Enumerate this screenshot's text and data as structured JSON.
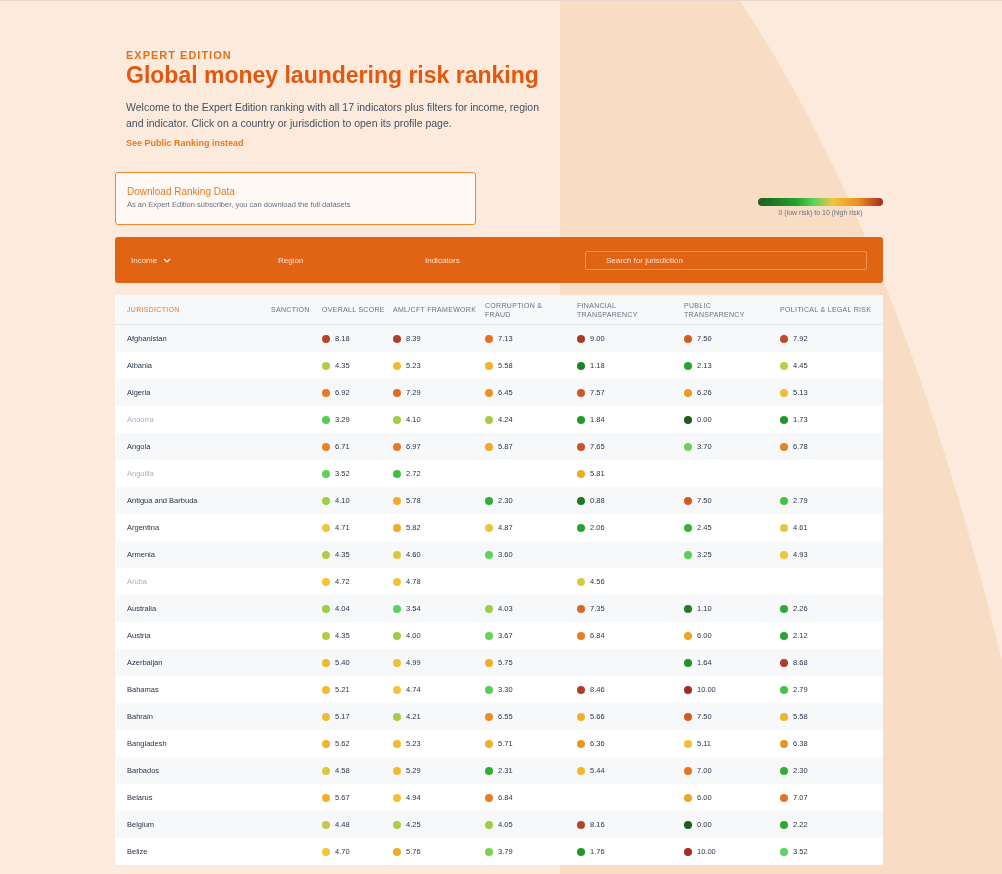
{
  "header": {
    "eyebrow": "EXPERT EDITION",
    "title": "Global money laundering risk ranking",
    "intro": "Welcome to the Expert Edition ranking with all 17 indicators plus filters for income, region and indicator. Click on a country or jurisdiction to open its profile page.",
    "public_link": "See Public Ranking instead"
  },
  "download": {
    "title": "Download Ranking Data",
    "text": "As an Expert Edition subscriber, you can download the full datasets"
  },
  "legend": {
    "caption": "0 (low risk) to 10 (high risk)"
  },
  "filters": [
    {
      "label": "Income",
      "dropdown": true
    },
    {
      "label": "Region",
      "dropdown": false
    },
    {
      "label": "Indicators",
      "dropdown": false
    }
  ],
  "search": {
    "placeholder": "Search for jurisdiction"
  },
  "table": {
    "columns": [
      "JURISDICTION",
      "SANCTION",
      "OVERALL SCORE",
      "AML/CFT FRAMEWORK",
      "CORRUPTION & FRAUD",
      "FINANCIAL TRANSPARENCY",
      "PUBLIC TRANSPARENCY",
      "POLITICAL & LEGAL RISK"
    ],
    "rows": [
      {
        "name": "Afghanistan",
        "disabled": false,
        "scores": {
          "overall": "8.18",
          "aml": "8.39",
          "corruption": "7.13",
          "financial": "9.00",
          "public": "7.50",
          "political": "7.92"
        }
      },
      {
        "name": "Albania",
        "disabled": false,
        "scores": {
          "overall": "4.35",
          "aml": "5.23",
          "corruption": "5.58",
          "financial": "1.18",
          "public": "2.13",
          "political": "4.45"
        }
      },
      {
        "name": "Algeria",
        "disabled": false,
        "scores": {
          "overall": "6.92",
          "aml": "7.29",
          "corruption": "6.45",
          "financial": "7.57",
          "public": "6.26",
          "political": "5.13"
        }
      },
      {
        "name": "Andorra",
        "disabled": true,
        "scores": {
          "overall": "3.29",
          "aml": "4.10",
          "corruption": "4.24",
          "financial": "1.84",
          "public": "0.00",
          "political": "1.73"
        }
      },
      {
        "name": "Angola",
        "disabled": false,
        "scores": {
          "overall": "6.71",
          "aml": "6.97",
          "corruption": "5.87",
          "financial": "7.65",
          "public": "3.70",
          "political": "6.78"
        }
      },
      {
        "name": "Anguilla",
        "disabled": true,
        "scores": {
          "overall": "3.52",
          "aml": "2.72",
          "financial": "5.81"
        }
      },
      {
        "name": "Antigua and Barbuda",
        "disabled": false,
        "scores": {
          "overall": "4.10",
          "aml": "5.78",
          "corruption": "2.30",
          "financial": "0.88",
          "public": "7.50",
          "political": "2.79"
        }
      },
      {
        "name": "Argentina",
        "disabled": false,
        "scores": {
          "overall": "4.71",
          "aml": "5.82",
          "corruption": "4.87",
          "financial": "2.06",
          "public": "2.45",
          "political": "4.61"
        }
      },
      {
        "name": "Armenia",
        "disabled": false,
        "scores": {
          "overall": "4.35",
          "aml": "4.60",
          "corruption": "3.60",
          "public": "3.25",
          "political": "4.93"
        }
      },
      {
        "name": "Aruba",
        "disabled": true,
        "scores": {
          "overall": "4.72",
          "aml": "4.78",
          "financial": "4.56"
        }
      },
      {
        "name": "Australia",
        "disabled": false,
        "scores": {
          "overall": "4.04",
          "aml": "3.54",
          "corruption": "4.03",
          "financial": "7.35",
          "public": "1.10",
          "political": "2.26"
        }
      },
      {
        "name": "Austria",
        "disabled": false,
        "scores": {
          "overall": "4.35",
          "aml": "4.00",
          "corruption": "3.67",
          "financial": "6.84",
          "public": "6.00",
          "political": "2.12"
        }
      },
      {
        "name": "Azerbaijan",
        "disabled": false,
        "scores": {
          "overall": "5.40",
          "aml": "4.99",
          "corruption": "5.75",
          "public": "1.64",
          "political": "8.68"
        }
      },
      {
        "name": "Bahamas",
        "disabled": false,
        "scores": {
          "overall": "5.21",
          "aml": "4.74",
          "corruption": "3.30",
          "financial": "8.46",
          "public": "10.00",
          "political": "2.79"
        }
      },
      {
        "name": "Bahrain",
        "disabled": false,
        "scores": {
          "overall": "5.17",
          "aml": "4.21",
          "corruption": "6.55",
          "financial": "5.66",
          "public": "7.50",
          "political": "5.58"
        }
      },
      {
        "name": "Bangladesh",
        "disabled": false,
        "scores": {
          "overall": "5.62",
          "aml": "5.23",
          "corruption": "5.71",
          "financial": "6.36",
          "public": "5.11",
          "political": "6.38"
        }
      },
      {
        "name": "Barbados",
        "disabled": false,
        "scores": {
          "overall": "4.58",
          "aml": "5.29",
          "corruption": "2.31",
          "financial": "5.44",
          "public": "7.00",
          "political": "2.30"
        }
      },
      {
        "name": "Belarus",
        "disabled": false,
        "scores": {
          "overall": "5.67",
          "aml": "4.94",
          "corruption": "6.84",
          "public": "6.00",
          "political": "7.07"
        }
      },
      {
        "name": "Belgium",
        "disabled": false,
        "scores": {
          "overall": "4.48",
          "aml": "4.25",
          "corruption": "4.05",
          "financial": "8.16",
          "public": "0.00",
          "political": "2.22"
        }
      },
      {
        "name": "Belize",
        "disabled": false,
        "scores": {
          "overall": "4.70",
          "aml": "5.76",
          "corruption": "3.79",
          "financial": "1.76",
          "public": "10.00",
          "political": "3.52"
        }
      }
    ]
  }
}
